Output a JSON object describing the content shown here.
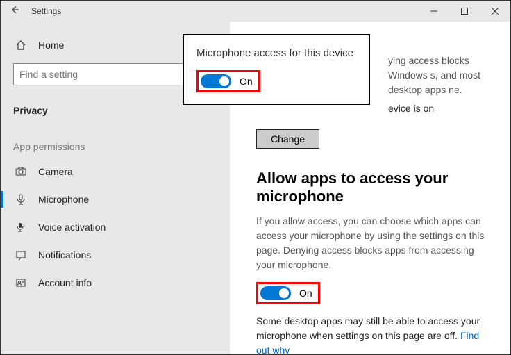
{
  "titlebar": {
    "title": "Settings"
  },
  "sidebar": {
    "home": "Home",
    "search_placeholder": "Find a setting",
    "section": "Privacy",
    "group": "App permissions",
    "items": {
      "camera": "Camera",
      "microphone": "Microphone",
      "voice": "Voice activation",
      "notifications": "Notifications",
      "account": "Account info"
    }
  },
  "popup": {
    "title": "Microphone access for this device",
    "toggle_label": "On"
  },
  "content": {
    "partial_text": "ying access blocks Windows s, and most desktop apps ne.",
    "device_status_suffix": "evice is on",
    "change_btn": "Change",
    "allow_heading": "Allow apps to access your microphone",
    "allow_para": "If you allow access, you can choose which apps can access your microphone by using the settings on this page. Denying access blocks apps from accessing your microphone.",
    "toggle_label": "On",
    "footer_text": "Some desktop apps may still be able to access your microphone when settings on this page are off. ",
    "footer_link": "Find out why"
  }
}
